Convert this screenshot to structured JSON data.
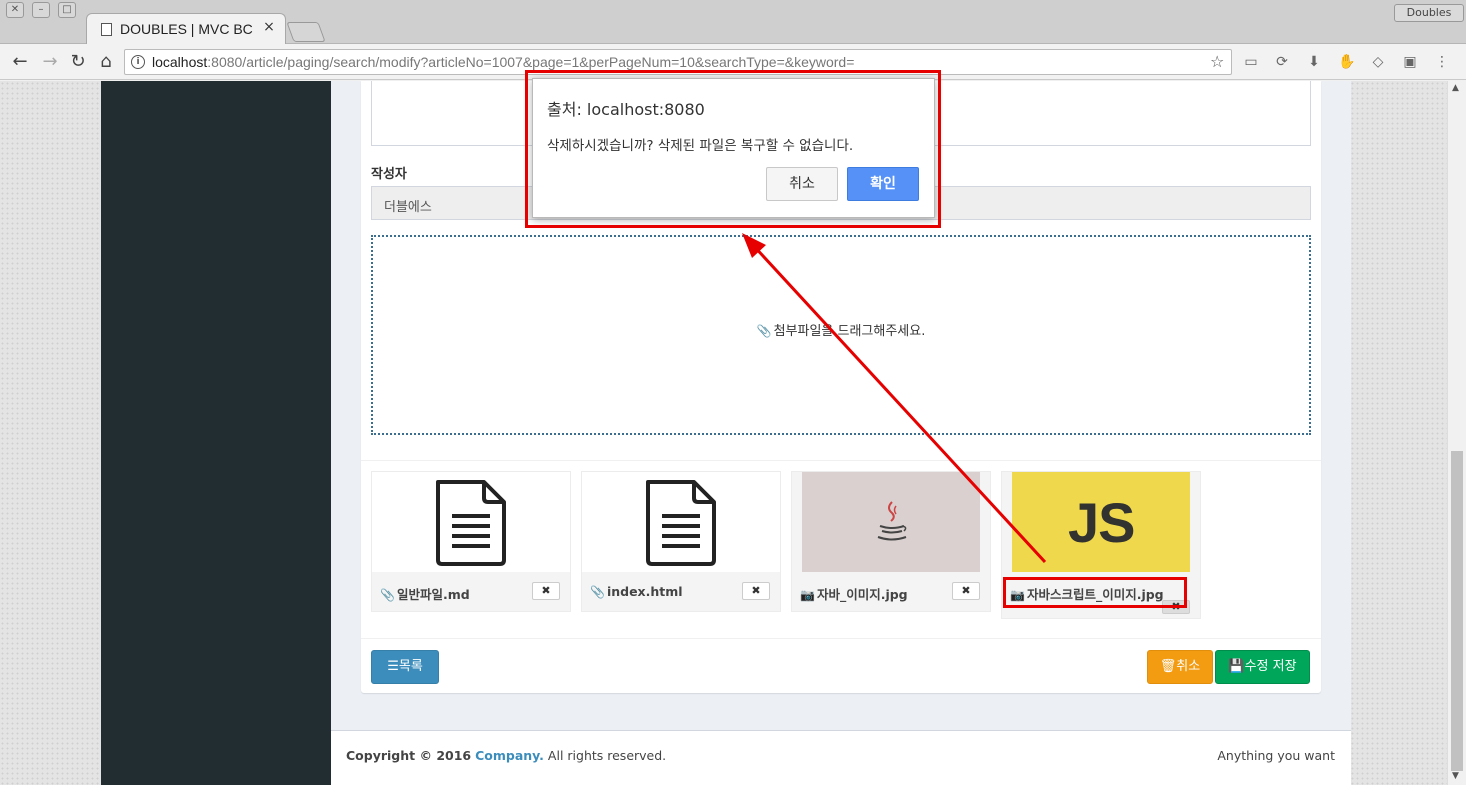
{
  "browser": {
    "tab_title": "DOUBLES | MVC BC",
    "tab_close": "×",
    "profile": "Doubles",
    "url_host": "localhost",
    "url_rest": ":8080/article/paging/search/modify?articleNo=1007&page=1&perPageNum=10&searchType=&keyword="
  },
  "form": {
    "writer_label": "작성자",
    "writer_value": "더블에스"
  },
  "dropzone": {
    "text": "첨부파일을 드래그해주세요."
  },
  "files": [
    {
      "name": "일반파일.md",
      "type": "document",
      "remove": "✖"
    },
    {
      "name": "index.html",
      "type": "document",
      "remove": "✖"
    },
    {
      "name": "자바_이미지.jpg",
      "type": "image",
      "remove": "✖"
    },
    {
      "name": "자바스크립트_이미지.jpg",
      "type": "image",
      "thumb_text": "JS",
      "remove": "✖"
    }
  ],
  "buttons": {
    "list": "목록",
    "cancel": "취소",
    "save": "수정 저장"
  },
  "footer": {
    "copyright_prefix": "Copyright © 2016",
    "company": "Company.",
    "rights": "All rights reserved.",
    "right_text": "Anything you want"
  },
  "dialog": {
    "origin": "출처: localhost:8080",
    "message": "삭제하시겠습니까? 삭제된 파일은 복구할 수 없습니다.",
    "cancel": "취소",
    "ok": "확인"
  },
  "colors": {
    "sidebar": "#222d32",
    "primary": "#3c8dbc",
    "warning": "#f39c12",
    "success": "#00a65a",
    "dialog_ok": "#5591f7",
    "annotation": "#e60000",
    "js_thumb": "#f0d84c"
  }
}
